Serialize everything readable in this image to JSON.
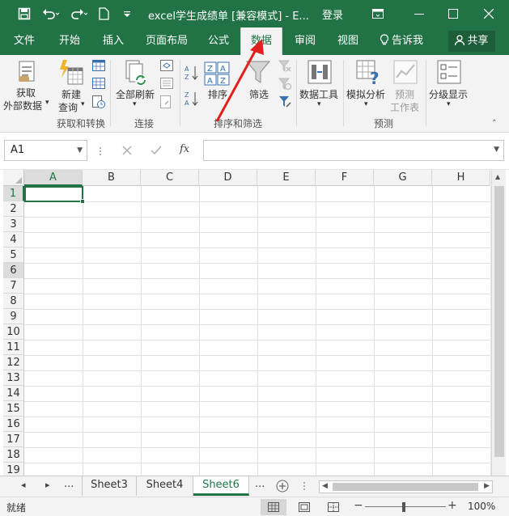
{
  "titlebar": {
    "save_icon": "save-icon",
    "undo_icon": "undo-icon",
    "redo_icon": "redo-icon",
    "new_icon": "new-document-icon",
    "qat_icon": "customize-qat-icon",
    "title": "excel学生成绩单 [兼容模式] - E...",
    "login": "登录",
    "ribbon_display_icon": "ribbon-display-options-icon",
    "minimize_icon": "minimize-icon",
    "maximize_icon": "maximize-icon",
    "close_icon": "close-icon",
    "bg_color": "#217346"
  },
  "tabs": {
    "items": [
      "文件",
      "开始",
      "插入",
      "页面布局",
      "公式",
      "数据",
      "审阅",
      "视图"
    ],
    "active": "数据",
    "tell_me": "告诉我",
    "share": "共享"
  },
  "ribbon": {
    "get_external": "获取",
    "get_external_2": "外部数据",
    "new_query": "新建",
    "new_query_2": "查询",
    "refresh_all": "全部刷新",
    "sort": "排序",
    "filter": "筛选",
    "data_tools": "数据工具",
    "what_if": "模拟分析",
    "forecast": "预测",
    "forecast_2": "工作表",
    "outline": "分级显示",
    "groups": {
      "get_transform": "获取和转换",
      "connections": "连接",
      "sort_filter": "排序和筛选",
      "forecast": "预测"
    }
  },
  "formula_bar": {
    "name_box": "A1",
    "cancel_icon": "cancel-icon",
    "enter_icon": "enter-icon",
    "fx": "fx",
    "formula": ""
  },
  "grid": {
    "columns": [
      "A",
      "B",
      "C",
      "D",
      "E",
      "F",
      "G",
      "H"
    ],
    "rows": [
      "1",
      "2",
      "3",
      "4",
      "5",
      "6",
      "7",
      "8",
      "9",
      "10",
      "11",
      "12",
      "13",
      "14",
      "15",
      "16",
      "17",
      "18",
      "19"
    ],
    "selected_cell": "A1"
  },
  "sheets": {
    "ellipsis_left": "...",
    "items": [
      "Sheet3",
      "Sheet4",
      "Sheet6"
    ],
    "active": "Sheet6",
    "ellipsis_right": "...",
    "add_icon": "add-sheet-icon"
  },
  "status": {
    "ready": "就绪",
    "zoom": "100%",
    "minus": "−",
    "plus": "+"
  },
  "annotation": {
    "arrow_color": "#e0201c"
  }
}
